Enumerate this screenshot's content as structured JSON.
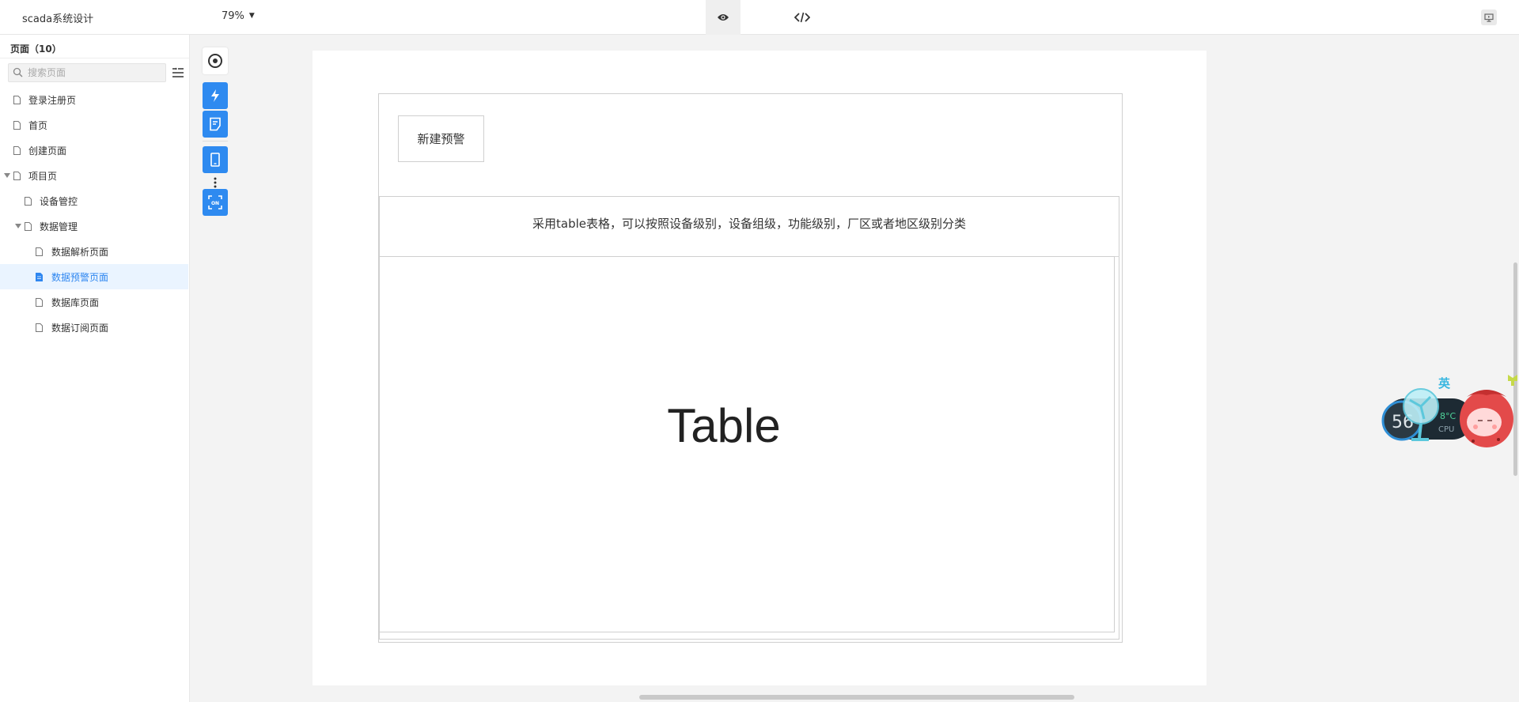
{
  "app": {
    "title": "scada系统设计",
    "zoom": "79%"
  },
  "sidebar": {
    "header": "页面（10）",
    "search_placeholder": "搜索页面",
    "items": [
      {
        "label": "登录注册页",
        "level": 0,
        "expandable": false,
        "active": false
      },
      {
        "label": "首页",
        "level": 0,
        "expandable": false,
        "active": false
      },
      {
        "label": "创建页面",
        "level": 0,
        "expandable": false,
        "active": false
      },
      {
        "label": "项目页",
        "level": 0,
        "expandable": true,
        "active": false
      },
      {
        "label": "设备管控",
        "level": 1,
        "expandable": false,
        "active": false
      },
      {
        "label": "数据管理",
        "level": 1,
        "expandable": true,
        "active": false
      },
      {
        "label": "数据解析页面",
        "level": 2,
        "expandable": false,
        "active": false
      },
      {
        "label": "数据预警页面",
        "level": 2,
        "expandable": false,
        "active": true
      },
      {
        "label": "数据库页面",
        "level": 2,
        "expandable": false,
        "active": false
      },
      {
        "label": "数据订阅页面",
        "level": 2,
        "expandable": false,
        "active": false
      }
    ]
  },
  "toolbar": {
    "tools": [
      "target-icon",
      "lightning-icon",
      "note-icon",
      "tablet-icon",
      "more-vertical-icon",
      "on-scan-icon"
    ],
    "on_label": "ON"
  },
  "canvas": {
    "new_alert_button": "新建预警",
    "description": "采用table表格，可以按照设备级别，设备组级，功能级别，厂区或者地区级别分类",
    "table_placeholder": "Table"
  },
  "widget": {
    "cpu_value": "56",
    "temp": "8°C",
    "cpu_label": "CPU",
    "ime_label": "英"
  },
  "colors": {
    "accent": "#2e8af0",
    "active_bg": "#eaf4ff",
    "active_text": "#2e86f0"
  }
}
